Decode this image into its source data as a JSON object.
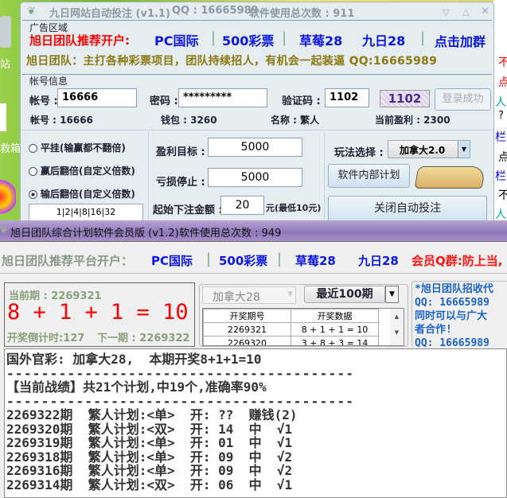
{
  "desktop": {
    "left_labels": [
      "站",
      "救箱"
    ],
    "right_chars": [
      "不",
      "点",
      "人",
      "?",
      "栏",
      "点",
      "栏",
      "不",
      "人"
    ]
  },
  "top_window": {
    "title": "九日网站自动投注 (v1.1)",
    "qq": "QQ : 16665989",
    "usage": "软件使用总次数 : 911",
    "ad_group": "广告区域",
    "ad_prefix": "旭日团队推荐开户:",
    "ad_links": [
      "PC国际",
      "500彩票",
      "草莓28",
      "九日28",
      "点击加群"
    ],
    "slogan": "旭日团队：主打各种彩票项目，团队持续招人，有机会一起装逼 QQ:16665989",
    "account_group": "帐号信息",
    "account_label": "帐号 :",
    "account_value": "16666",
    "password_label": "密码 :",
    "password_value": "*********",
    "captcha_label": "验证码 :",
    "captcha_value": "1102",
    "captcha_image": "1102",
    "login_button": "登录成功",
    "info": {
      "account": "帐号 : 16666",
      "wallet": "钱包 : 3260",
      "name": "名称 : 繁人",
      "profit": "当前盈利 : 2300"
    },
    "radios": [
      {
        "label": "平挂(输赢都不翻倍)",
        "checked": false
      },
      {
        "label": "赢后翻倍(自定义倍数)",
        "checked": false
      },
      {
        "label": "输后翻倍(自定义倍数)",
        "checked": true
      }
    ],
    "multipliers": "1|2|4|8|16|32",
    "profit_target_label": "盈利目标 :",
    "profit_target": "5000",
    "stop_loss_label": "亏损停止 :",
    "stop_loss": "5000",
    "start_bet_label": "起始下注金额 :",
    "start_bet": "20",
    "start_bet_note": "元(最低10元)",
    "play_label": "玩法选择 :",
    "play_value": "加拿大2.0",
    "internal_plan_button": "软件内部计划",
    "close_auto_button": "关闭自动投注"
  },
  "bottom_window": {
    "title": "旭日团队综合计划软件会员版 (v1.2)",
    "usage": "软件使用总次数 : 949",
    "ad_prefix": "旭日团队推荐平台开户：",
    "ad_links": [
      "PC国际",
      "500彩票",
      "草莓28",
      "九日28"
    ],
    "ad_red": "会员Q群:防上当,",
    "current_period": "当前期 : 2269321",
    "result": "8 + 1 + 1 = 10",
    "countdown": "开奖倒计时:127",
    "next_period": "下一期 : 2269322",
    "lottery_select": "加拿大28",
    "range_select": "最近100期",
    "table": {
      "headers": [
        "开奖期号",
        "开奖数据"
      ],
      "rows": [
        [
          "2269321",
          "8 + 1 + 1 = 10"
        ],
        [
          "2269320",
          "3 + 8 + 3 = 14"
        ]
      ]
    },
    "notice": [
      "*旭日团队招收代",
      "QQ: 16665989",
      "同时可以与广大",
      "者合作!",
      "QQ: 16665989"
    ],
    "log": {
      "header": "国外官彩: 加拿大28,  本期开奖8+1+1=10",
      "divider": "----------------------------------------",
      "stats": "【当前战绩】共21个计划,中19个,准确率90%",
      "rows": [
        "2269322期  繁人计划:<单>  开: ??  赚钱(2)",
        "2269320期  繁人计划:<双>  开: 14  中  √1",
        "2269319期  繁人计划:<单>  开: 01  中  √1",
        "2269318期  繁人计划:<单>  开: 09  中  √2",
        "2269316期  繁人计划:<单>  开: 09  中  √2",
        "2269314期  繁人计划:<双>  开: 06  中  √1"
      ]
    }
  }
}
